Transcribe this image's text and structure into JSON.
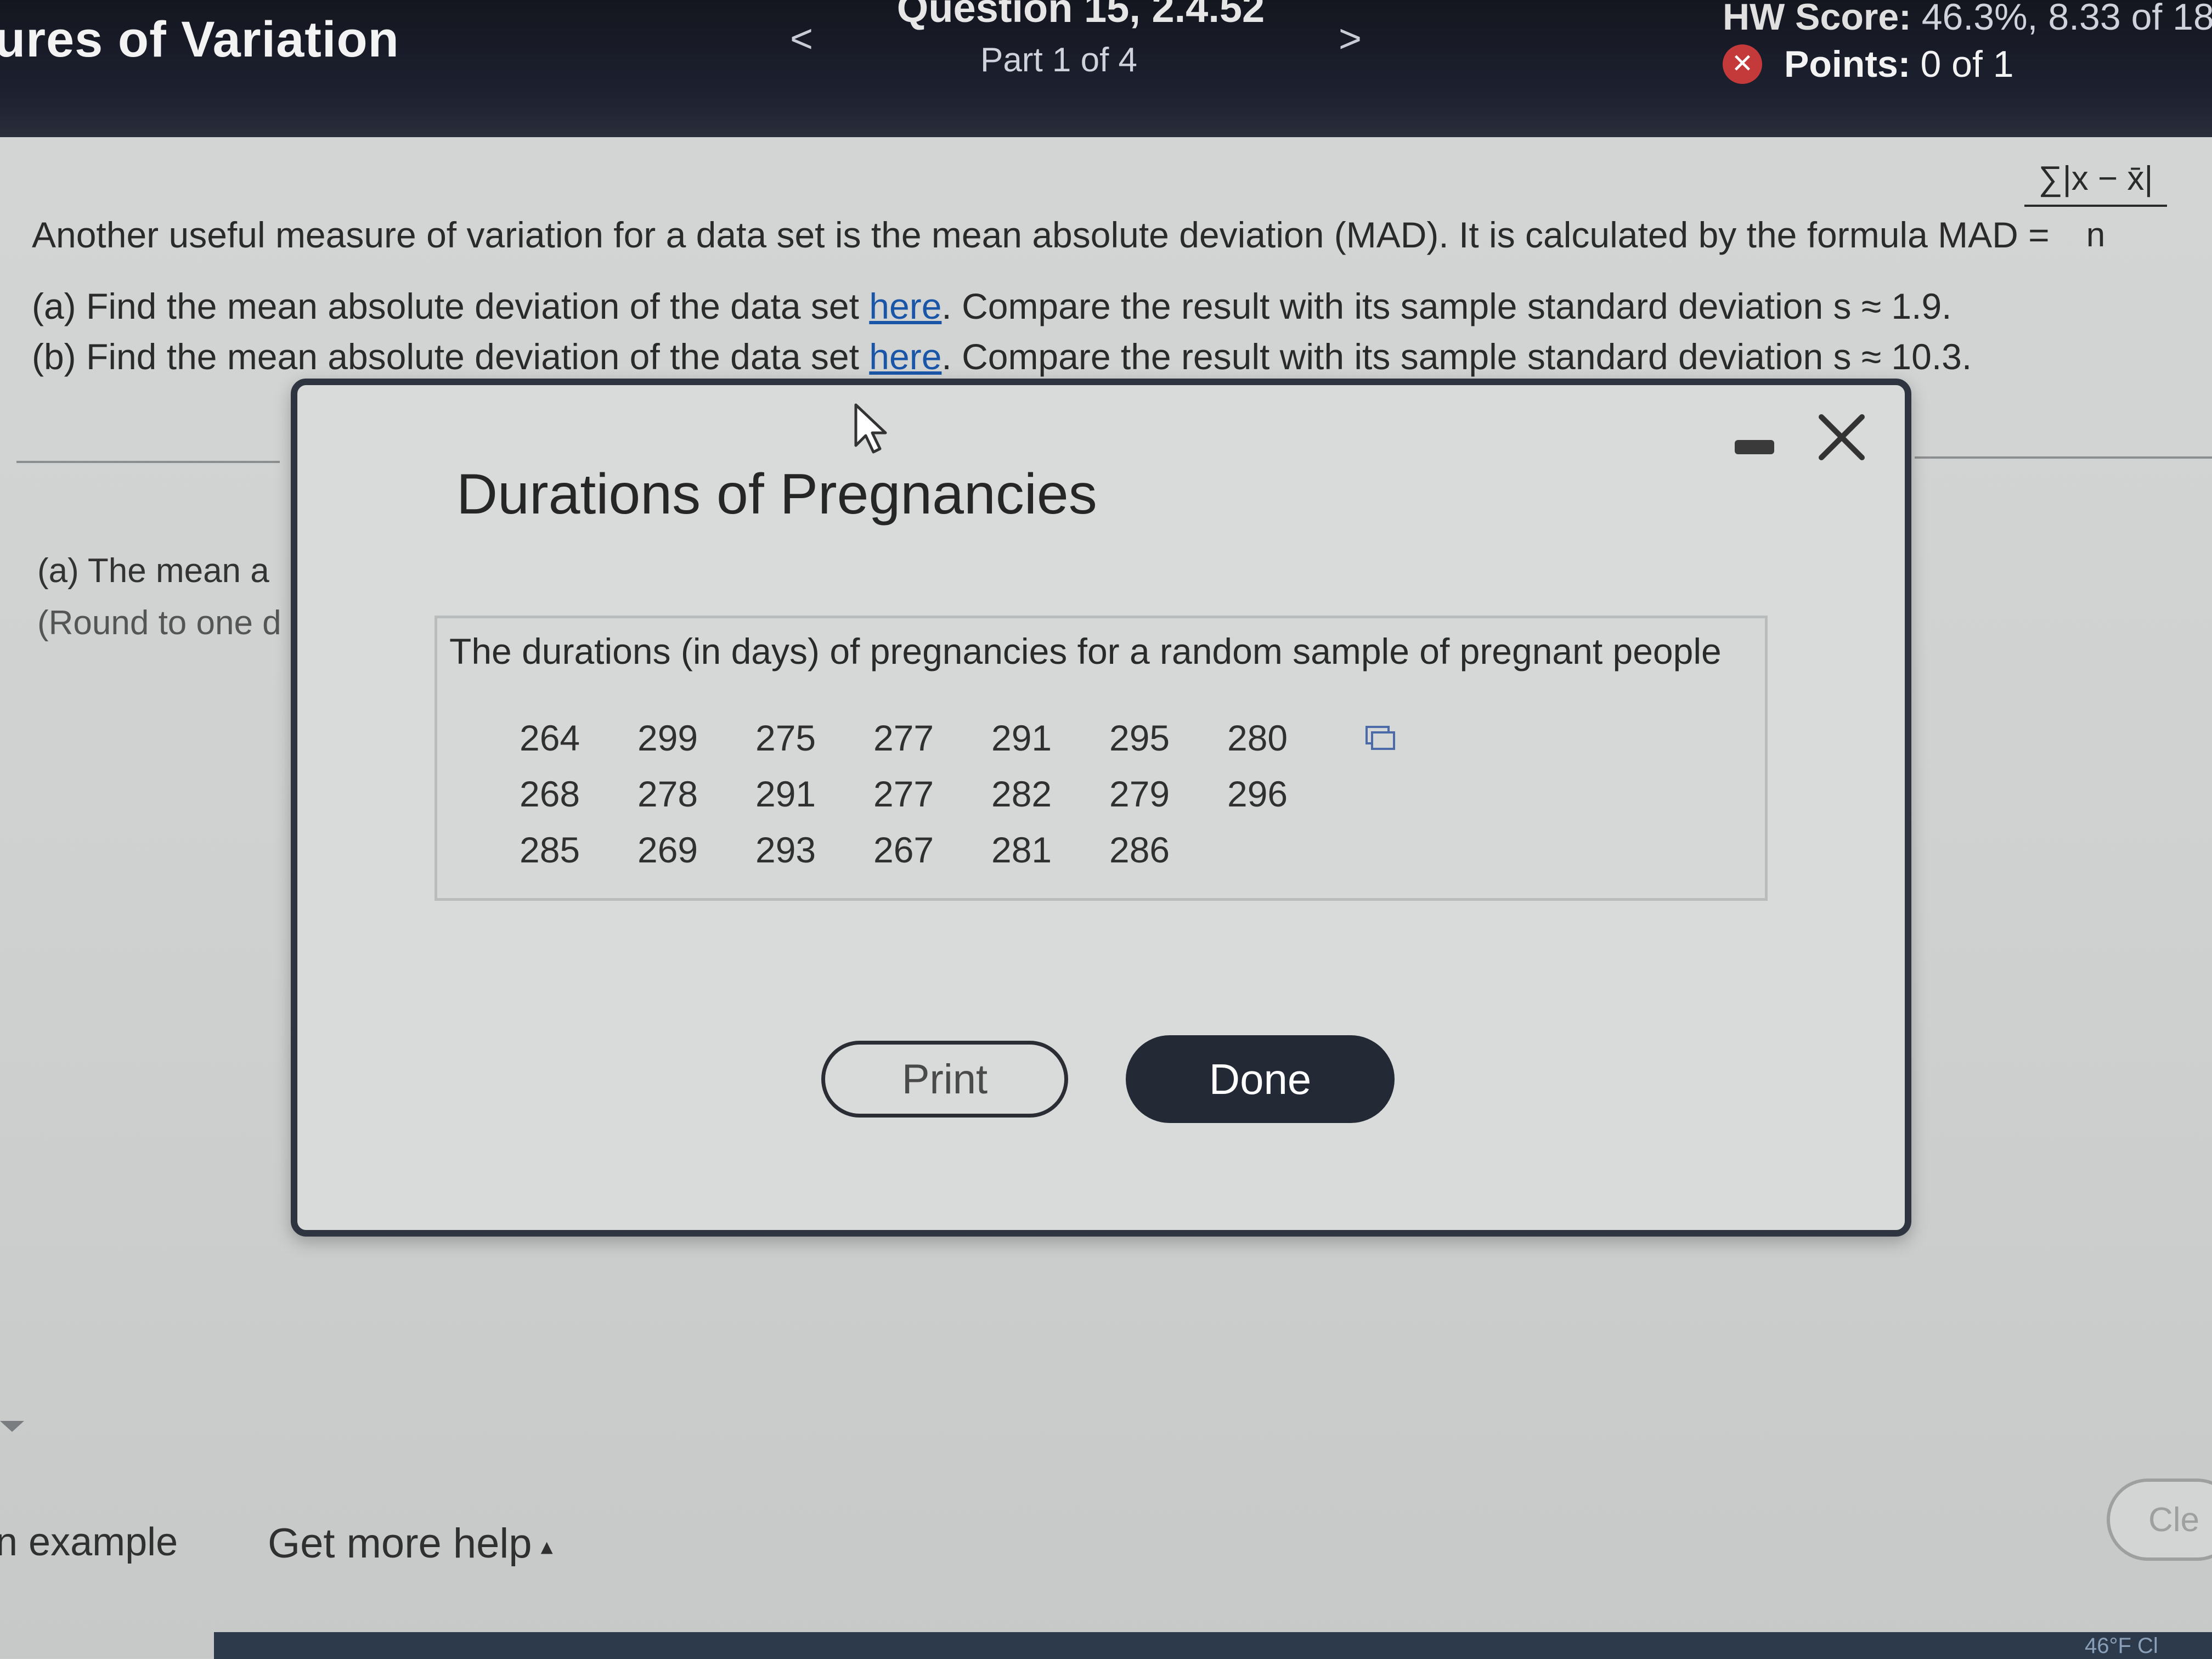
{
  "header": {
    "section_title": "ures of Variation",
    "prev_arrow": "<",
    "next_arrow": ">",
    "question_title": "Question 15, 2.4.52",
    "question_part": "Part 1 of 4",
    "hw_score_label": "HW Score:",
    "hw_score_value": "46.3%, 8.33 of 18",
    "points_label": "Points:",
    "points_value": "0 of 1",
    "points_status_icon": "x-circle-icon",
    "status_color": "#c43a3a"
  },
  "question": {
    "intro": "Another useful measure of variation for a data set is the mean absolute deviation (MAD). It is calculated by the formula MAD =",
    "formula_numerator": "∑|x − x̄|",
    "formula_denominator": "n",
    "part_a_prefix": "(a) Find the mean absolute deviation of the data set ",
    "part_a_link": "here",
    "part_a_suffix": ". Compare the result with its sample standard deviation s ≈ 1.9.",
    "part_b_prefix": "(b) Find the mean absolute deviation of the data set ",
    "part_b_link": "here",
    "part_b_suffix": ". Compare the result with its sample standard deviation s ≈ 10.3.",
    "link_color": "#1a56a8"
  },
  "answer_area": {
    "part_a_label": "(a) The mean a",
    "round_hint": "(Round to one d"
  },
  "modal": {
    "title": "Durations of Pregnancies",
    "caption": "The durations (in days) of pregnancies for a random sample of pregnant people",
    "data_rows": [
      [
        "264",
        "299",
        "275",
        "277",
        "291",
        "295",
        "280"
      ],
      [
        "268",
        "278",
        "291",
        "277",
        "282",
        "279",
        "296"
      ],
      [
        "285",
        "269",
        "293",
        "267",
        "281",
        "286"
      ]
    ],
    "print_label": "Print",
    "done_label": "Done",
    "icons": [
      "cursor-icon",
      "minimize-icon",
      "close-icon",
      "copy-icon"
    ],
    "done_color": "#242a35"
  },
  "footer": {
    "example_label": "n example",
    "more_help_label": "Get more help",
    "more_help_caret": "▴",
    "clear_label": "Cle",
    "taskbar_text": "46°F  Cl"
  }
}
